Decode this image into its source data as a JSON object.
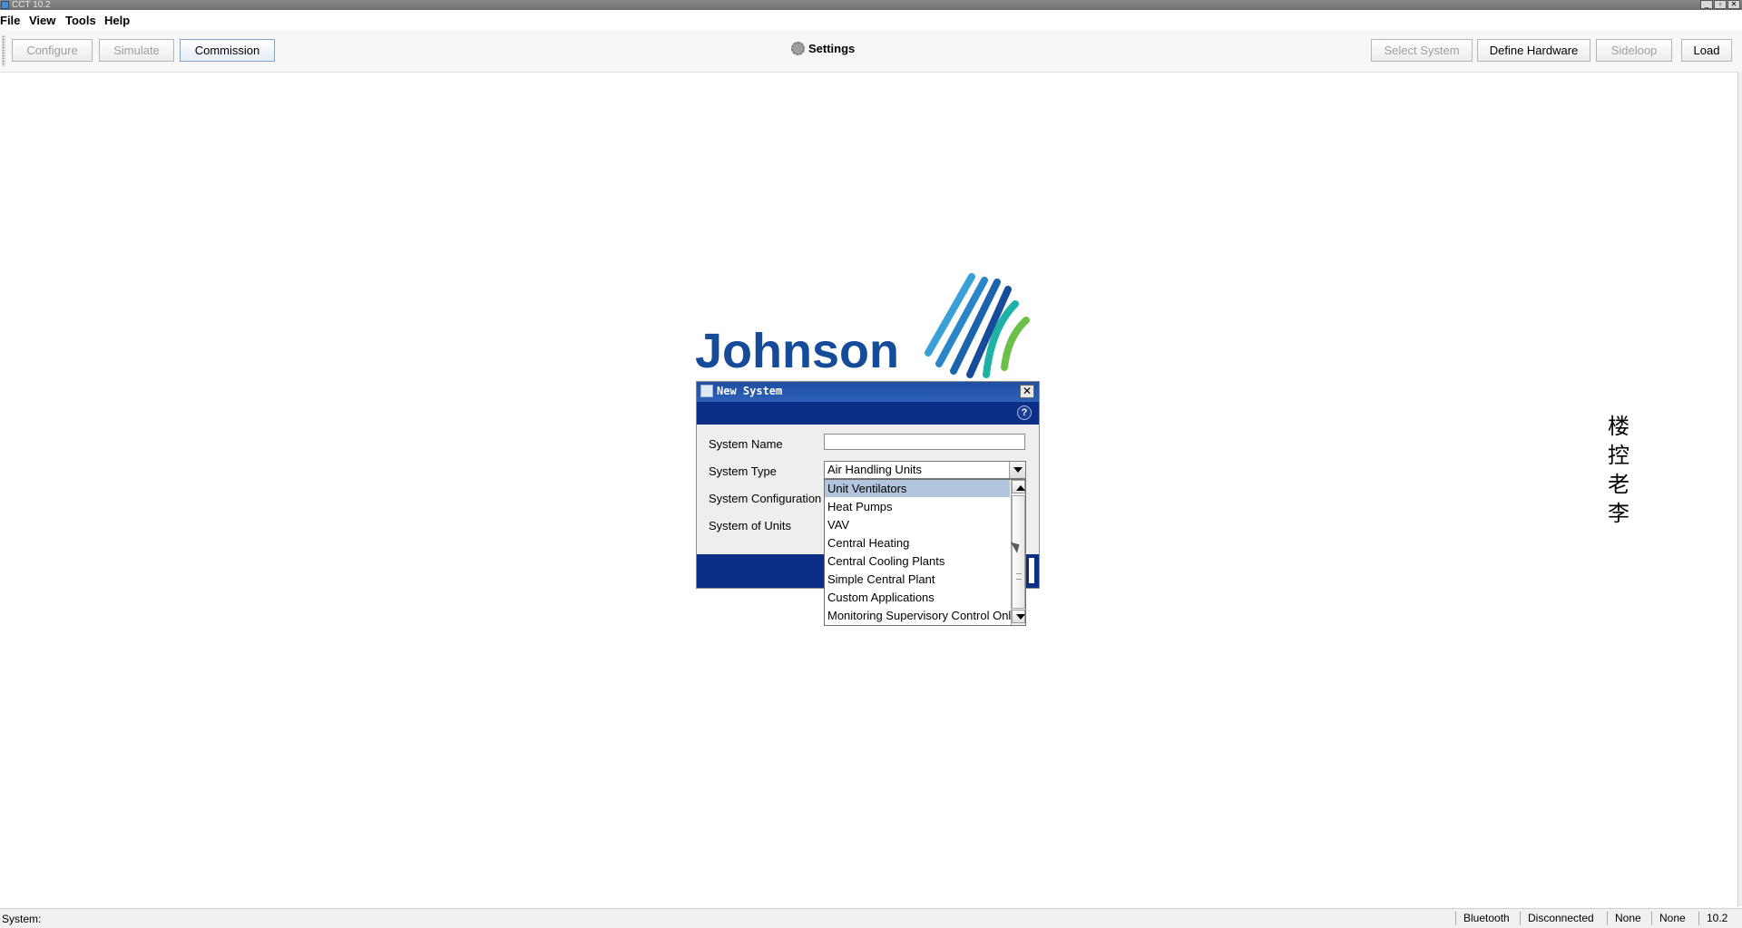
{
  "window": {
    "title": "CCT 10.2",
    "controls": [
      "_",
      "▫",
      "✕"
    ]
  },
  "menu": [
    "File",
    "View",
    "Tools",
    "Help"
  ],
  "toolbar": {
    "left": [
      {
        "label": "Configure",
        "enabled": false
      },
      {
        "label": "Simulate",
        "enabled": false
      },
      {
        "label": "Commission",
        "enabled": true
      }
    ],
    "center_label": "Settings",
    "right": [
      {
        "label": "Select System",
        "enabled": false
      },
      {
        "label": "Define Hardware",
        "enabled": true
      },
      {
        "label": "Sideloop",
        "enabled": false
      },
      {
        "label": "Load",
        "enabled": true
      }
    ]
  },
  "logo": {
    "text": "Johnson",
    "colors": [
      "#164b9a",
      "#3aa0d8",
      "#1db2a5",
      "#6cc04a"
    ]
  },
  "watermark": [
    "楼",
    "控",
    "老",
    "李"
  ],
  "dialog": {
    "title": "New System",
    "help_icon": "?",
    "close_icon": "✕",
    "fields": {
      "system_name_label": "System Name",
      "system_name_value": "",
      "system_type_label": "System Type",
      "system_type_value": "Air Handling Units",
      "system_configuration_label": "System Configuration",
      "system_of_units_label": "System of Units"
    },
    "dropdown_options": [
      "Unit Ventilators",
      "Heat Pumps",
      "VAV",
      "Central Heating",
      "Central Cooling Plants",
      "Simple Central Plant",
      "Custom Applications",
      "Monitoring Supervisory Control Only"
    ],
    "highlighted_option": "Unit Ventilators"
  },
  "status": {
    "system_label": "System:",
    "items": [
      "Bluetooth",
      "Disconnected",
      "None",
      "None",
      "10.2"
    ]
  }
}
